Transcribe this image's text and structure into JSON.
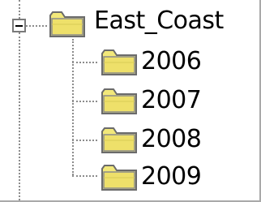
{
  "tree": {
    "root": {
      "label": "East_Coast",
      "expanded": true,
      "icon": "folder-open-icon"
    },
    "children": [
      {
        "label": "2006",
        "icon": "folder-icon"
      },
      {
        "label": "2007",
        "icon": "folder-icon"
      },
      {
        "label": "2008",
        "icon": "folder-icon"
      },
      {
        "label": "2009",
        "icon": "folder-icon"
      }
    ]
  }
}
